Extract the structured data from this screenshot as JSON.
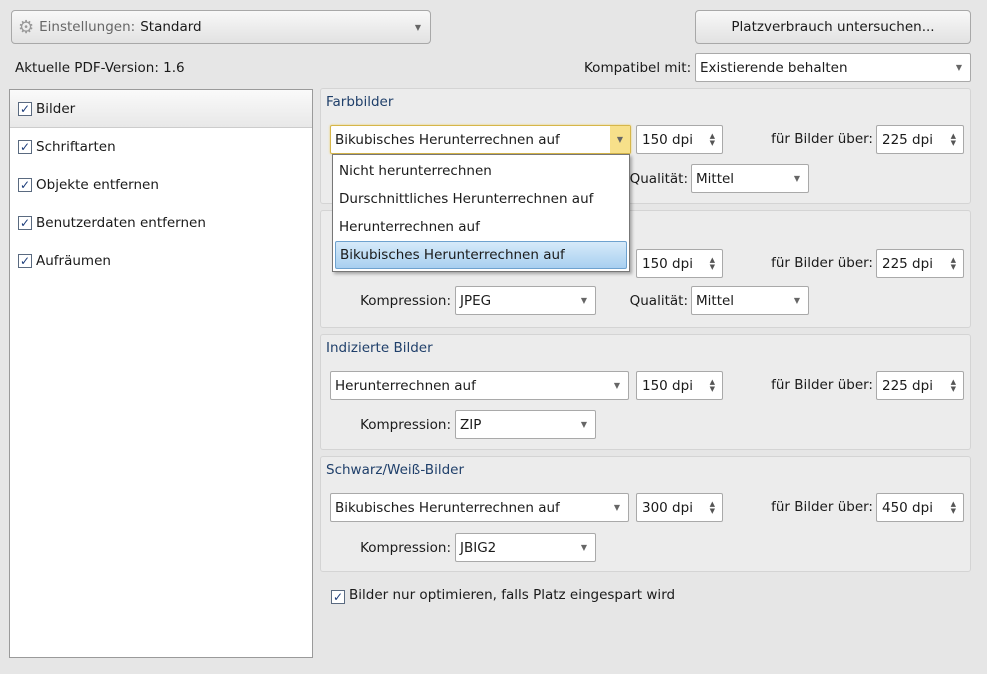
{
  "header": {
    "settings_label": "Einstellungen:",
    "settings_value": "Standard",
    "audit_button": "Platzverbrauch untersuchen...",
    "pdf_version": "Aktuelle PDF-Version: 1.6",
    "compat_label": "Kompatibel mit:",
    "compat_value": "Existierende behalten"
  },
  "sidebar": {
    "items": [
      {
        "label": "Bilder",
        "checked": true
      },
      {
        "label": "Schriftarten",
        "checked": true
      },
      {
        "label": "Objekte entfernen",
        "checked": true
      },
      {
        "label": "Benutzerdaten entfernen",
        "checked": true
      },
      {
        "label": "Aufräumen",
        "checked": true
      }
    ]
  },
  "labels": {
    "above": "für Bilder über:",
    "compression": "Kompression:",
    "quality": "Qualität:"
  },
  "color": {
    "title": "Farbbilder",
    "method": "Bikubisches Herunterrechnen auf",
    "dpi": "150 dpi",
    "above_dpi": "225 dpi",
    "quality": "Mittel"
  },
  "gray": {
    "dpi": "150 dpi",
    "above_dpi": "225 dpi",
    "compression": "JPEG",
    "quality": "Mittel"
  },
  "indexed": {
    "title": "Indizierte Bilder",
    "method": "Herunterrechnen auf",
    "dpi": "150 dpi",
    "above_dpi": "225 dpi",
    "compression": "ZIP"
  },
  "bw": {
    "title": "Schwarz/Weiß-Bilder",
    "method": "Bikubisches Herunterrechnen auf",
    "dpi": "300 dpi",
    "above_dpi": "450 dpi",
    "compression": "JBIG2"
  },
  "dropdown": {
    "options": [
      "Nicht herunterrechnen",
      "Durschnittliches Herunterrechnen auf",
      "Herunterrechnen auf",
      "Bikubisches Herunterrechnen auf"
    ],
    "selected_index": 3
  },
  "optimize_only": {
    "label": "Bilder nur optimieren, falls Platz eingespart wird",
    "checked": true
  }
}
